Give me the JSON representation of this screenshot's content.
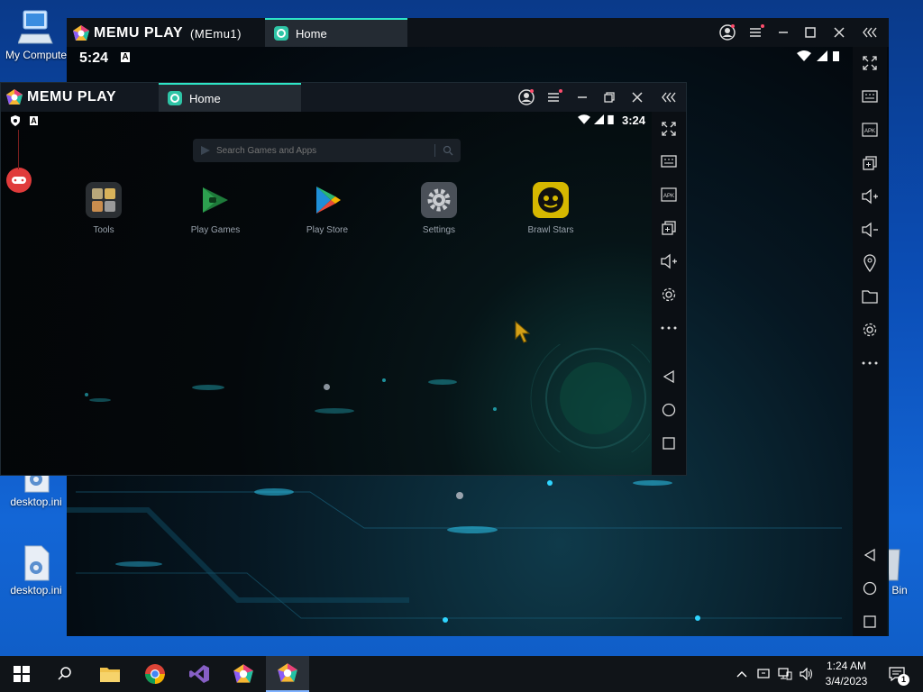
{
  "desktop": {
    "icons": [
      {
        "label": "My Compute"
      },
      {
        "label": "desktop.ini"
      },
      {
        "label": "desktop.ini"
      },
      {
        "label": "Bin"
      }
    ]
  },
  "back_window": {
    "brand": "MEMU PLAY",
    "instance": "(MEmu1)",
    "tab_label": "Home",
    "clock": "5:24",
    "status_letter": "A"
  },
  "front_window": {
    "brand": "MEMU PLAY",
    "tab_label": "Home",
    "clock": "3:24",
    "status_letter": "A",
    "search": {
      "placeholder": "Search Games and Apps"
    },
    "apps": [
      {
        "label": "Tools",
        "icon": "tools-folder-icon"
      },
      {
        "label": "Play Games",
        "icon": "play-games-icon"
      },
      {
        "label": "Play Store",
        "icon": "play-store-icon"
      },
      {
        "label": "Settings",
        "icon": "settings-gear-icon"
      },
      {
        "label": "Brawl Stars",
        "icon": "brawl-stars-icon"
      }
    ]
  },
  "taskbar": {
    "time": "1:24 AM",
    "date": "3/4/2023",
    "notification_count": "1"
  },
  "colors": {
    "accent": "#2ee6c6",
    "titlebar": "#121820",
    "tab": "#242b33",
    "desktop_blue": "#0b4db5"
  }
}
